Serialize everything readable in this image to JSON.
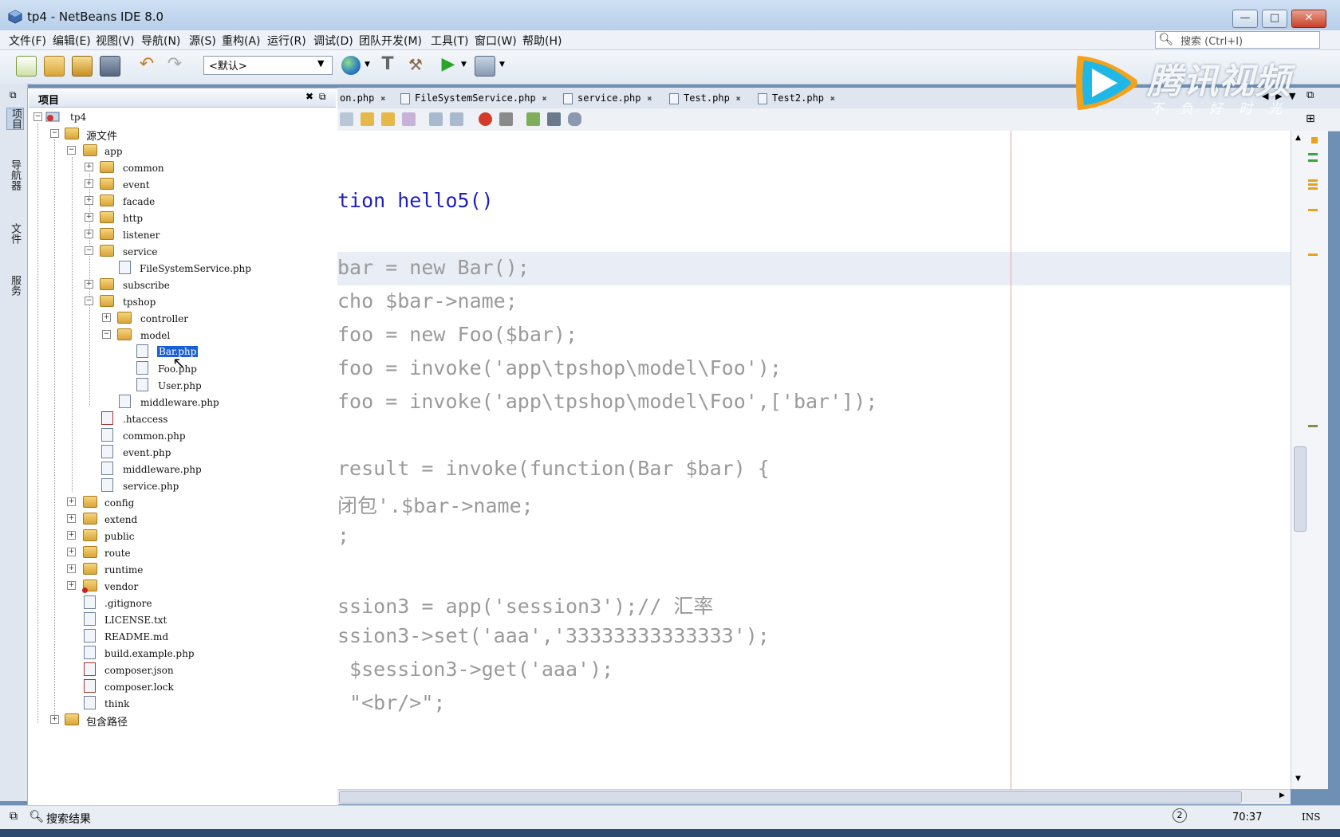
{
  "window": {
    "title": "tp4 - NetBeans IDE 8.0",
    "minimize": "—",
    "maximize": "□",
    "close": "✕"
  },
  "menu": [
    "文件(F)",
    "编辑(E)",
    "视图(V)",
    "导航(N)",
    "源(S)",
    "重构(A)",
    "运行(R)",
    "调试(D)",
    "团队开发(M)",
    "工具(T)",
    "窗口(W)",
    "帮助(H)"
  ],
  "search": {
    "placeholder": "搜索 (Ctrl+I)"
  },
  "toolbar": {
    "config_value": "<默认>"
  },
  "side_tabs": [
    "项目",
    "导航器",
    "文件",
    "服务"
  ],
  "project_panel": {
    "title": "项目"
  },
  "tree": [
    {
      "label": "tp4"
    },
    {
      "label": "源文件"
    },
    {
      "label": "app"
    },
    {
      "label": "common"
    },
    {
      "label": "event"
    },
    {
      "label": "facade"
    },
    {
      "label": "http"
    },
    {
      "label": "listener"
    },
    {
      "label": "service"
    },
    {
      "label": "FileSystemService.php"
    },
    {
      "label": "subscribe"
    },
    {
      "label": "tpshop"
    },
    {
      "label": "controller"
    },
    {
      "label": "model"
    },
    {
      "label": "Bar.php"
    },
    {
      "label": "Foo.php"
    },
    {
      "label": "User.php"
    },
    {
      "label": "middleware.php"
    },
    {
      "label": ".htaccess"
    },
    {
      "label": "common.php"
    },
    {
      "label": "event.php"
    },
    {
      "label": "middleware.php"
    },
    {
      "label": "service.php"
    },
    {
      "label": "config"
    },
    {
      "label": "extend"
    },
    {
      "label": "public"
    },
    {
      "label": "route"
    },
    {
      "label": "runtime"
    },
    {
      "label": "vendor"
    },
    {
      "label": ".gitignore"
    },
    {
      "label": "LICENSE.txt"
    },
    {
      "label": "README.md"
    },
    {
      "label": "build.example.php"
    },
    {
      "label": "composer.json"
    },
    {
      "label": "composer.lock"
    },
    {
      "label": "think"
    },
    {
      "label": "包含路径"
    }
  ],
  "editor_tabs": [
    "on.php",
    "FileSystemService.php",
    "service.php",
    "Test.php",
    "Test2.php"
  ],
  "code_lines": [
    "tion hello5()",
    "bar = new Bar();",
    "cho $bar->name;",
    "foo = new Foo($bar);",
    "foo = invoke('app\\tpshop\\model\\Foo');",
    "foo = invoke('app\\tpshop\\model\\Foo',['bar']);",
    "result = invoke(function(Bar $bar) {",
    "闭包'.$bar->name;",
    ";",
    "ssion3 = app('session3');// 汇率",
    "ssion3->set('aaa','33333333333333');",
    " $session3->get('aaa');",
    " \"<br/>\";"
  ],
  "status": {
    "search_results": "搜索结果",
    "position": "70:37",
    "insert_mode": "INS"
  },
  "watermark": {
    "name": "腾讯视频",
    "slogan": "不负好时光"
  },
  "colors": {
    "keyword": "#1f1fbf",
    "selection": "#1a5fd6",
    "titlebar": "#c4d8f0"
  }
}
